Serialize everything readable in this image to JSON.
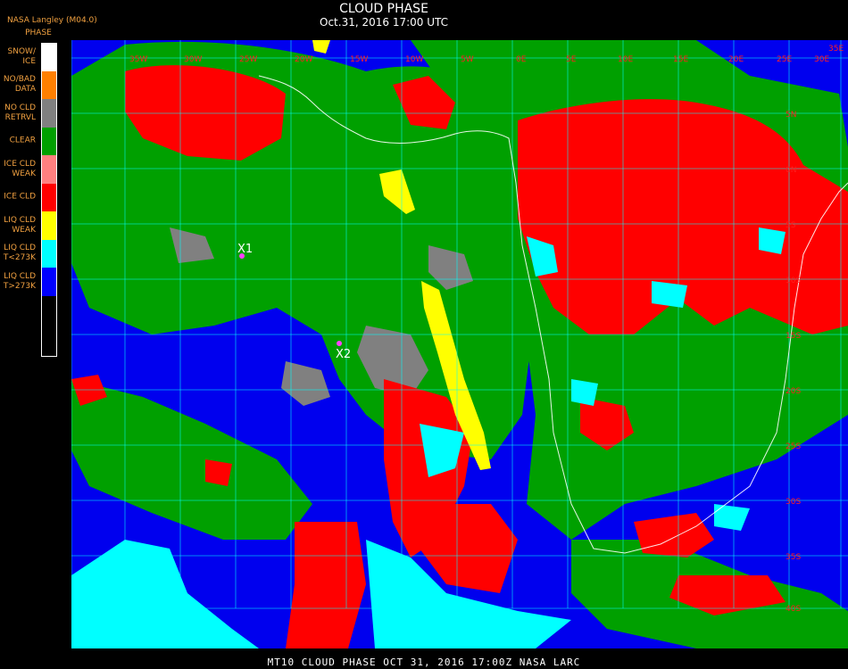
{
  "header": {
    "org": "NASA Langley (M04.0)",
    "product": "PHASE",
    "title": "CLOUD PHASE",
    "subtitle": "Oct.31, 2016 17:00 UTC"
  },
  "legend": [
    {
      "label": "SNOW/\nICE",
      "color": "#ffffff"
    },
    {
      "label": "NO/BAD\nDATA",
      "color": "#ff8000"
    },
    {
      "label": "NO CLD\nRETRVL",
      "color": "#808080"
    },
    {
      "label": "CLEAR",
      "color": "#00a000"
    },
    {
      "label": "ICE CLD\nWEAK",
      "color": "#ff8080"
    },
    {
      "label": "ICE CLD",
      "color": "#ff0000"
    },
    {
      "label": "LIQ CLD\nWEAK",
      "color": "#ffff00"
    },
    {
      "label": "LIQ CLD\nT<273K",
      "color": "#00ffff"
    },
    {
      "label": "LIQ CLD\nT>273K",
      "color": "#0000ff"
    }
  ],
  "map": {
    "top_labels": [
      "35W",
      "30W",
      "25W",
      "20W",
      "15W",
      "10W",
      "5W",
      "0E",
      "5E",
      "10E",
      "15E",
      "20E",
      "25E",
      "30E",
      "35E"
    ],
    "right_labels": [
      "5N",
      "0N",
      "5S",
      "10S",
      "15S",
      "20S",
      "25S",
      "30S",
      "35S",
      "40S"
    ],
    "markers": [
      {
        "label": "X1"
      },
      {
        "label": "X2"
      }
    ]
  },
  "footer": "MT10  CLOUD PHASE   OCT 31, 2016 17:00Z   NASA LARC"
}
